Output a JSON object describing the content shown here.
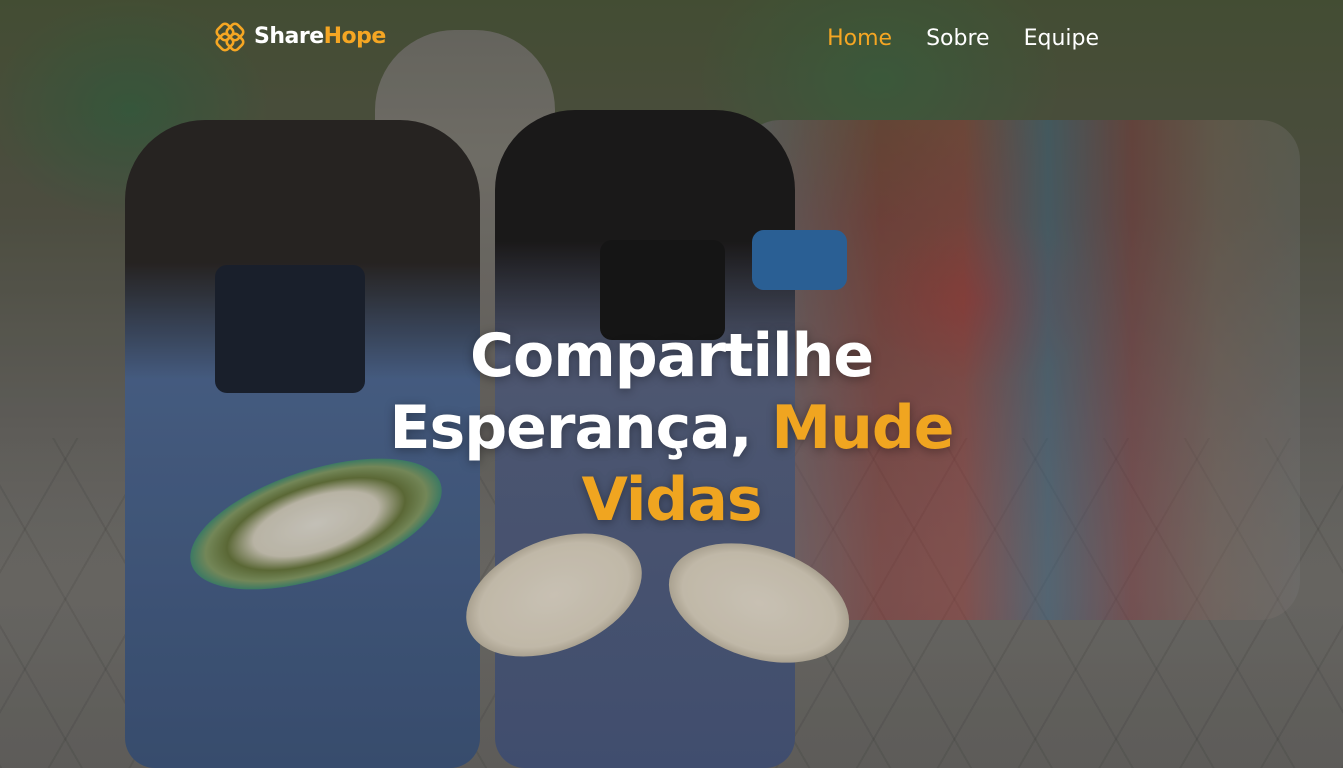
{
  "brand": {
    "name_part1": "Share",
    "name_part2": "Hope",
    "logo_icon": "interlocking-rings-icon",
    "accent_color": "#f5a623"
  },
  "nav": {
    "items": [
      {
        "label": "Home",
        "active": true
      },
      {
        "label": "Sobre",
        "active": false
      },
      {
        "label": "Equipe",
        "active": false
      }
    ]
  },
  "hero": {
    "line1": "Compartilhe",
    "line2_white": "Esperança, ",
    "line2_accent": "Mude",
    "line3_accent": "Vidas",
    "text_color": "#ffffff",
    "accent_color": "#f0a520"
  }
}
